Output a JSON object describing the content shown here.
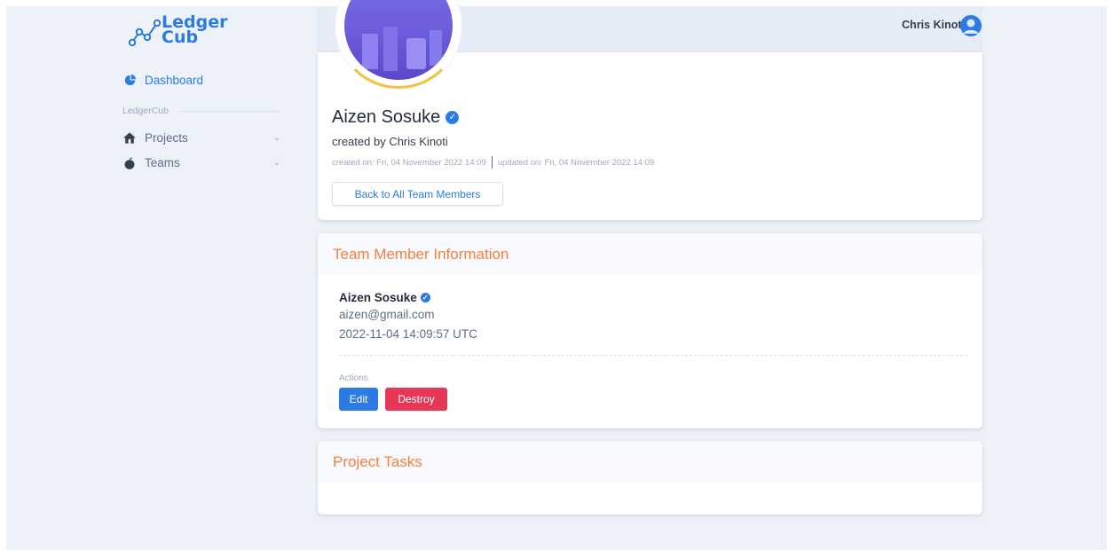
{
  "brand": {
    "name_line1": "Ledger",
    "name_line2": "Cub",
    "logo_icon": "graph-nodes-icon"
  },
  "sidebar": {
    "dashboard": {
      "label": "Dashboard",
      "icon": "pie-chart-icon"
    },
    "section_label": "LedgerCub",
    "items": [
      {
        "label": "Projects",
        "icon": "home-icon"
      },
      {
        "label": "Teams",
        "icon": "apple-icon"
      }
    ]
  },
  "topbar": {
    "user_name": "Chris Kinoti",
    "avatar_icon": "user-avatar-icon"
  },
  "profile": {
    "name": "Aizen Sosuke",
    "created_by": "created by Chris Kinoti",
    "created_on": "created on: Fri, 04 November 2022 14:09",
    "updated_on": "updated on: Fri, 04 November 2022 14:09",
    "back_button": "Back to All Team Members"
  },
  "team_member": {
    "header": "Team Member Information",
    "name": "Aizen Sosuke",
    "email": "aizen@gmail.com",
    "created": "2022-11-04 14:09:57 UTC",
    "actions_label": "Actions",
    "edit_label": "Edit",
    "destroy_label": "Destroy"
  },
  "tasks": {
    "header": "Project Tasks"
  },
  "colors": {
    "primary": "#2c7be5",
    "danger": "#e63757",
    "header_accent": "#f5803e",
    "background": "#edf2f9"
  }
}
